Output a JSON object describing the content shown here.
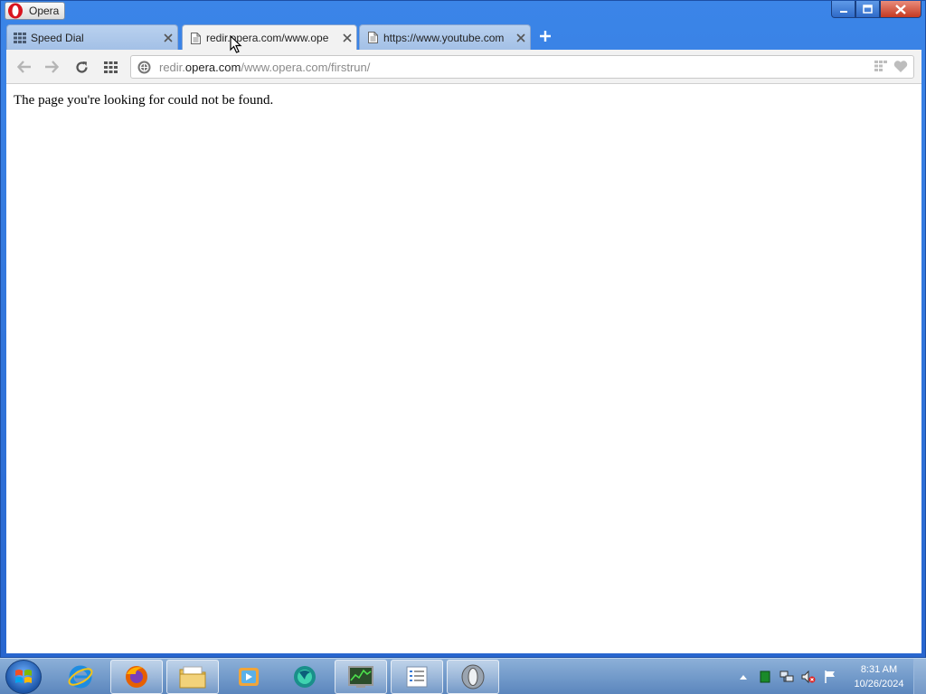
{
  "window": {
    "app_name": "Opera"
  },
  "tabs": [
    {
      "title": "Speed Dial",
      "icon": "speed-dial-icon",
      "active": false
    },
    {
      "title": "redir.opera.com/www.ope",
      "icon": "page-icon",
      "active": true
    },
    {
      "title": "https://www.youtube.com",
      "icon": "page-icon",
      "active": false
    }
  ],
  "address": {
    "prefix": "redir.",
    "host": "opera.com",
    "path": "/www.opera.com/firstrun/"
  },
  "page": {
    "message": "The page you're looking for could not be found."
  },
  "taskbar": {
    "items": [
      "internet-explorer-icon",
      "firefox-icon",
      "file-explorer-icon",
      "media-player-icon",
      "browser-icon",
      "task-manager-icon",
      "notepad-icon",
      "opera-icon"
    ],
    "clock_time": "8:31 AM",
    "clock_date": "10/26/2024"
  },
  "colors": {
    "frame": "#2b6fd1",
    "close_button": "#c53a22",
    "opera_red": "#d8141e"
  }
}
